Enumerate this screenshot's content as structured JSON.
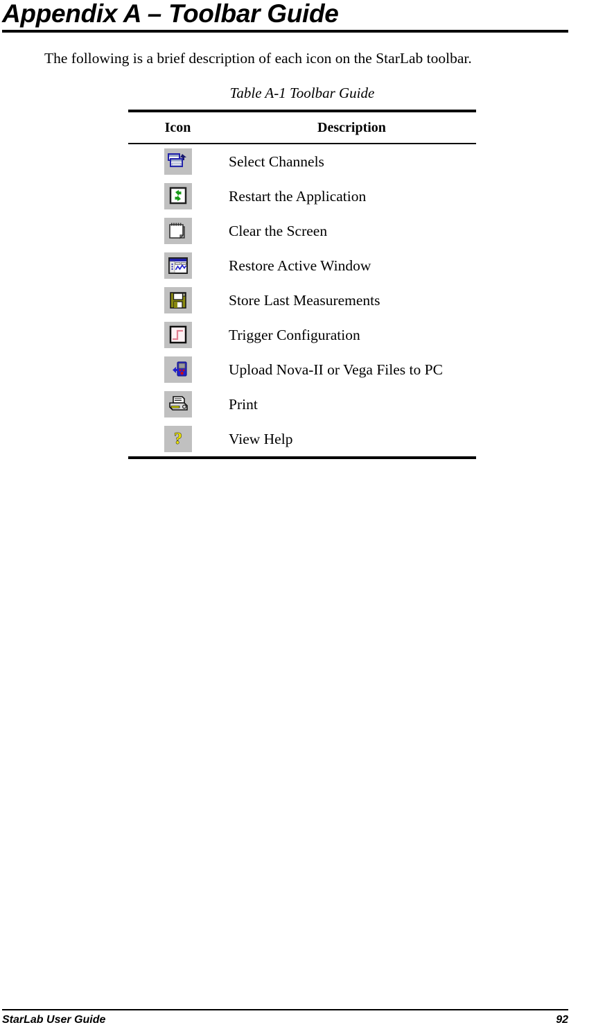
{
  "document": {
    "heading": "Appendix A – Toolbar Guide",
    "intro": "The following is a brief description of each icon on the StarLab toolbar.",
    "table_caption": "Table A-1 Toolbar Guide"
  },
  "table": {
    "headers": {
      "icon": "Icon",
      "description": "Description"
    },
    "rows": [
      {
        "icon_name": "select-channels-icon",
        "description": "Select Channels"
      },
      {
        "icon_name": "restart-application-icon",
        "description": "Restart the Application"
      },
      {
        "icon_name": "clear-screen-icon",
        "description": "Clear the Screen"
      },
      {
        "icon_name": "restore-active-window-icon",
        "description": "Restore Active Window"
      },
      {
        "icon_name": "store-last-measurements-icon",
        "description": "Store Last Measurements"
      },
      {
        "icon_name": "trigger-configuration-icon",
        "description": "Trigger Configuration"
      },
      {
        "icon_name": "upload-files-to-pc-icon",
        "description": "Upload Nova-II or Vega Files to PC"
      },
      {
        "icon_name": "print-icon",
        "description": "Print"
      },
      {
        "icon_name": "view-help-icon",
        "description": "View Help"
      }
    ]
  },
  "footer": {
    "guide_name": "StarLab User Guide",
    "page_number": "92"
  },
  "colors": {
    "text": "#000000",
    "page_background": "#ffffff",
    "icon_chip_background": "#c0c0c0",
    "icon_blue": "#2222aa",
    "icon_green": "#1a9a1a",
    "icon_yellow": "#c8c800",
    "icon_red": "#d01010",
    "icon_pink": "#e08090",
    "icon_help_yellow": "#e8e000"
  }
}
